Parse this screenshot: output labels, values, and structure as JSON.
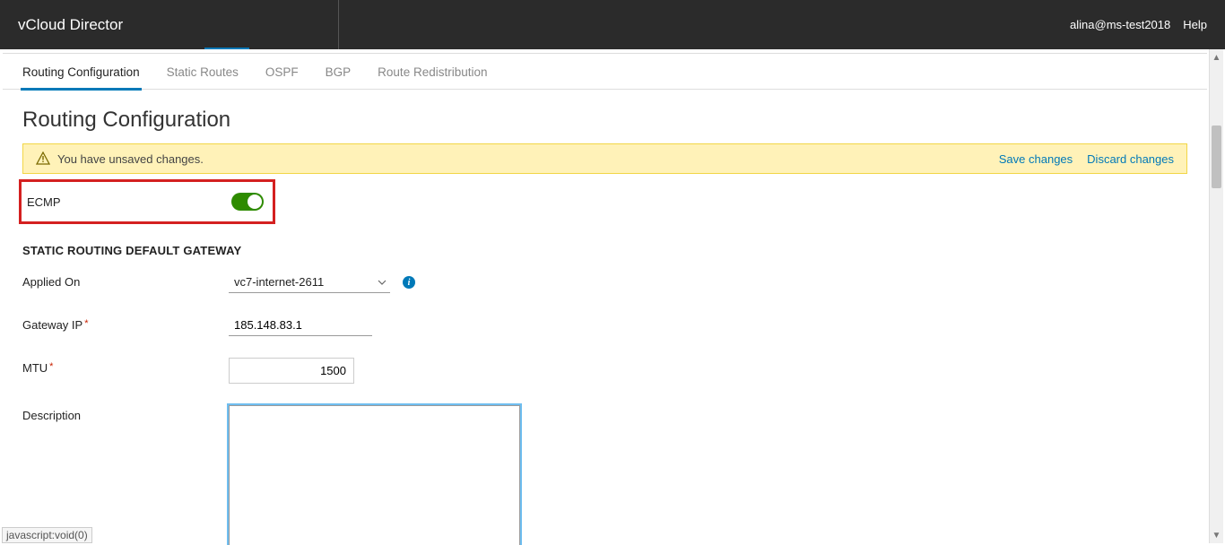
{
  "header": {
    "brand": "vCloud Director",
    "user": "alina@ms-test2018",
    "help": "Help"
  },
  "tabs": {
    "items": [
      "Routing Configuration",
      "Static Routes",
      "OSPF",
      "BGP",
      "Route Redistribution"
    ]
  },
  "page": {
    "title": "Routing Configuration"
  },
  "alert": {
    "message": "You have unsaved changes.",
    "save": "Save changes",
    "discard": "Discard changes"
  },
  "ecmp": {
    "label": "ECMP",
    "enabled": true
  },
  "section": {
    "heading": "STATIC ROUTING DEFAULT GATEWAY"
  },
  "form": {
    "appliedOn": {
      "label": "Applied On",
      "value": "vc7-internet-2611"
    },
    "gatewayIp": {
      "label": "Gateway IP",
      "value": "185.148.83.1"
    },
    "mtu": {
      "label": "MTU",
      "value": "1500"
    },
    "description": {
      "label": "Description",
      "value": ""
    }
  },
  "status": {
    "text": "javascript:void(0)"
  }
}
